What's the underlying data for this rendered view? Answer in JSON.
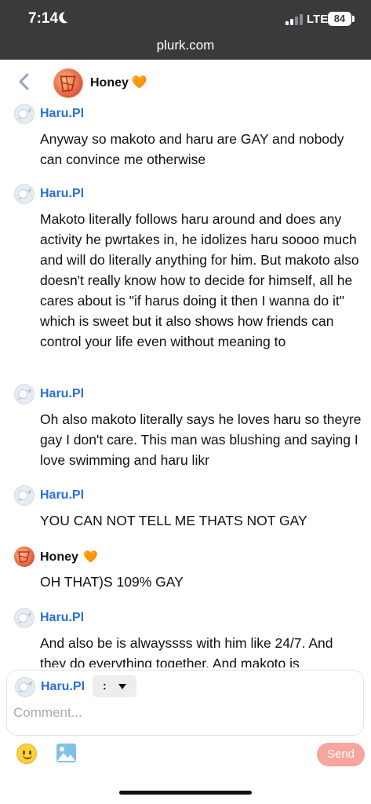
{
  "status_bar": {
    "time": "7:14",
    "network": "LTE",
    "battery": "84",
    "url": "plurk.com"
  },
  "header": {
    "name": "Honey",
    "emoji": "🧡"
  },
  "messages": [
    {
      "author": "Haru.Pl",
      "avatar": "haru",
      "text": "Anyway so makoto and haru are GAY and nobody can convince me otherwise"
    },
    {
      "author": "Haru.Pl",
      "avatar": "haru",
      "text": "Makoto literally follows haru around and does any activity he pwrtakes in, he idolizes haru soooo much and will do literally anything for him. But makoto also doesn't really know how to decide for himself, all he cares about is \"if harus doing it then I wanna do it\" which is sweet but it also shows how friends can control your life even without meaning to"
    },
    {
      "author": "Haru.Pl",
      "avatar": "haru",
      "text": "Oh also makoto literally says he loves haru so theyre gay I don't care. This man was blushing and saying I love swimming and haru likr"
    },
    {
      "author": "Haru.Pl",
      "avatar": "haru",
      "text": "YOU CAN NOT TELL ME THATS NOT GAY"
    },
    {
      "author": "Honey",
      "author_emoji": "🧡",
      "avatar": "honey",
      "text": "OH THAT)S 109% GAY"
    },
    {
      "author": "Haru.Pl",
      "avatar": "haru",
      "text": "And also be is alwayssss with him like 24/7. And they do everything together. And makoto is"
    }
  ],
  "composer": {
    "author": "Haru.Pl",
    "qualifier": ":",
    "placeholder": "Comment...",
    "send_label": "Send"
  },
  "icons": {
    "back": "chevron-left-icon",
    "emoji": "smiley-icon",
    "image": "image-icon",
    "qualifier_caret": "caret-down-icon"
  },
  "colors": {
    "author_link": "#2a6fd6",
    "send_button": "#f7a59d",
    "status_bar": "#3a3a3c",
    "back_chevron": "#8fa3c4"
  }
}
